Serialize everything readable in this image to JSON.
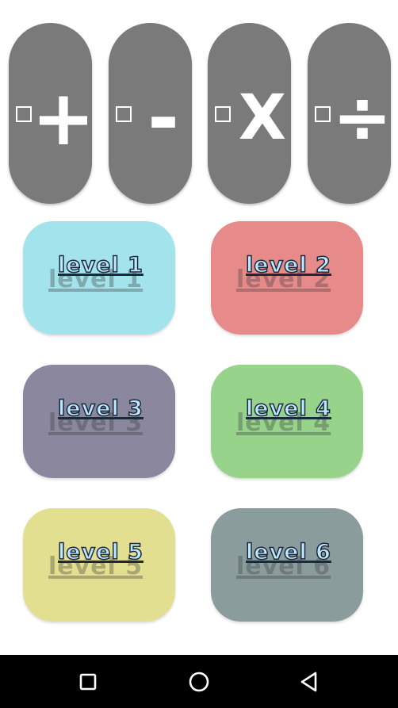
{
  "operations": [
    {
      "symbol": "+",
      "icon": "plus-icon",
      "checked": false
    },
    {
      "symbol": "-",
      "icon": "minus-icon",
      "checked": false
    },
    {
      "symbol": "X",
      "icon": "times-icon",
      "checked": false
    },
    {
      "symbol": "÷",
      "icon": "divide-icon",
      "checked": false
    }
  ],
  "levels": [
    {
      "label": "level 1",
      "color": "#a3e3ec"
    },
    {
      "label": "level 2",
      "color": "#e68a8a"
    },
    {
      "label": "level 3",
      "color": "#8b879f"
    },
    {
      "label": "level 4",
      "color": "#97d38a"
    },
    {
      "label": "level 5",
      "color": "#e3df91"
    },
    {
      "label": "level 6",
      "color": "#8a9c9b"
    }
  ],
  "navbar": {
    "buttons": [
      "recent-apps-icon",
      "home-icon",
      "back-icon"
    ]
  },
  "colors": {
    "operation_button": "#7a7a7a",
    "navbar": "#000000"
  }
}
